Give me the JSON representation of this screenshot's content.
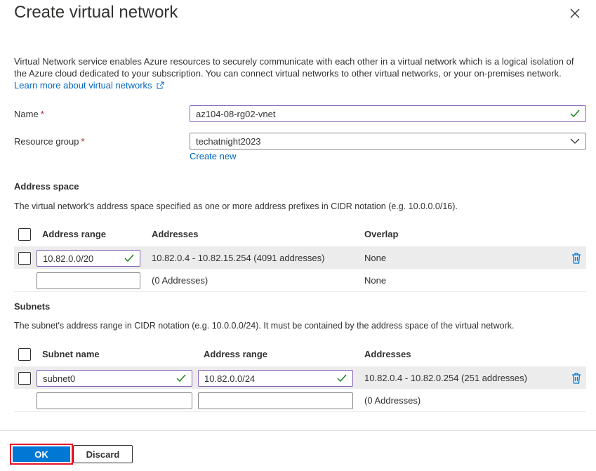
{
  "dialog": {
    "title": "Create virtual network",
    "description": "Virtual Network service enables Azure resources to securely communicate with each other in a virtual network which is a logical isolation of the Azure cloud dedicated to your subscription. You can connect virtual networks to other virtual networks, or your on-premises network.",
    "learn_more": "Learn more about virtual networks"
  },
  "form": {
    "name_label": "Name",
    "name_value": "az104-08-rg02-vnet",
    "rg_label": "Resource group",
    "rg_value": "techatnight2023",
    "create_new": "Create new",
    "required_mark": "*"
  },
  "address_space": {
    "heading": "Address space",
    "description": "The virtual network's address space specified as one or more address prefixes in CIDR notation (e.g. 10.0.0.0/16).",
    "columns": [
      "Address range",
      "Addresses",
      "Overlap"
    ],
    "rows": [
      {
        "range": "10.82.0.0/20",
        "addresses": "10.82.0.4 - 10.82.15.254 (4091 addresses)",
        "overlap": "None"
      },
      {
        "range": "",
        "addresses": "(0 Addresses)",
        "overlap": "None"
      }
    ]
  },
  "subnets": {
    "heading": "Subnets",
    "description": "The subnet's address range in CIDR notation (e.g. 10.0.0.0/24). It must be contained by the address space of the virtual network.",
    "columns": [
      "Subnet name",
      "Address range",
      "Addresses"
    ],
    "rows": [
      {
        "name": "subnet0",
        "range": "10.82.0.0/24",
        "addresses": "10.82.0.4 - 10.82.0.254 (251 addresses)"
      },
      {
        "name": "",
        "range": "",
        "addresses": "(0 Addresses)"
      }
    ]
  },
  "footer": {
    "ok_label": "OK",
    "discard_label": "Discard"
  },
  "colors": {
    "accent": "#0078d4",
    "valid_border": "#8764b8",
    "check": "#107c10",
    "highlight_outline": "#e81123"
  }
}
